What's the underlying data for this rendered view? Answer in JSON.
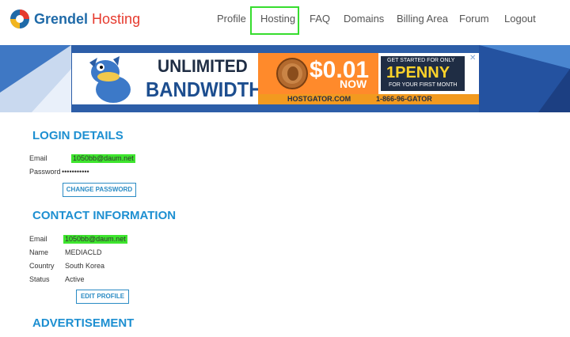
{
  "header": {
    "logo_part1": "Grendel",
    "logo_part2": "Hosting",
    "nav": [
      "Profile",
      "Hosting",
      "FAQ",
      "Domains",
      "Billing Area",
      "Forum",
      "Logout"
    ],
    "highlighted_nav": "Hosting",
    "highlight_color": "#36dd2e"
  },
  "ad": {
    "line1": "UNLIMITED",
    "line2": "BANDWIDTH",
    "price": "$0.01",
    "price_suffix": "NOW",
    "promo_top": "GET STARTED FOR ONLY",
    "promo_main": "1PENNY",
    "promo_bottom": "FOR YOUR FIRST MONTH",
    "site": "HOSTGATOR.COM",
    "phone": "1-866-96-GATOR",
    "close": "✕"
  },
  "login": {
    "title": "LOGIN DETAILS",
    "email_label": "Email",
    "email_value": "1050bb@daum.net",
    "password_label": "Password",
    "password_value": "•••••••••••",
    "button": "CHANGE PASSWORD"
  },
  "contact": {
    "title": "CONTACT INFORMATION",
    "email_label": "Email",
    "email_value": "1050bb@daum.net",
    "name_label": "Name",
    "name_value": "MEDIACLD",
    "country_label": "Country",
    "country_value": "South Korea",
    "status_label": "Status",
    "status_value": "Active",
    "button": "EDIT PROFILE"
  },
  "advertisement": {
    "title": "ADVERTISEMENT"
  },
  "colors": {
    "heading": "#1d8fd1",
    "email_highlight": "#3ee52e",
    "banner_bg": "#2d5ea8"
  }
}
